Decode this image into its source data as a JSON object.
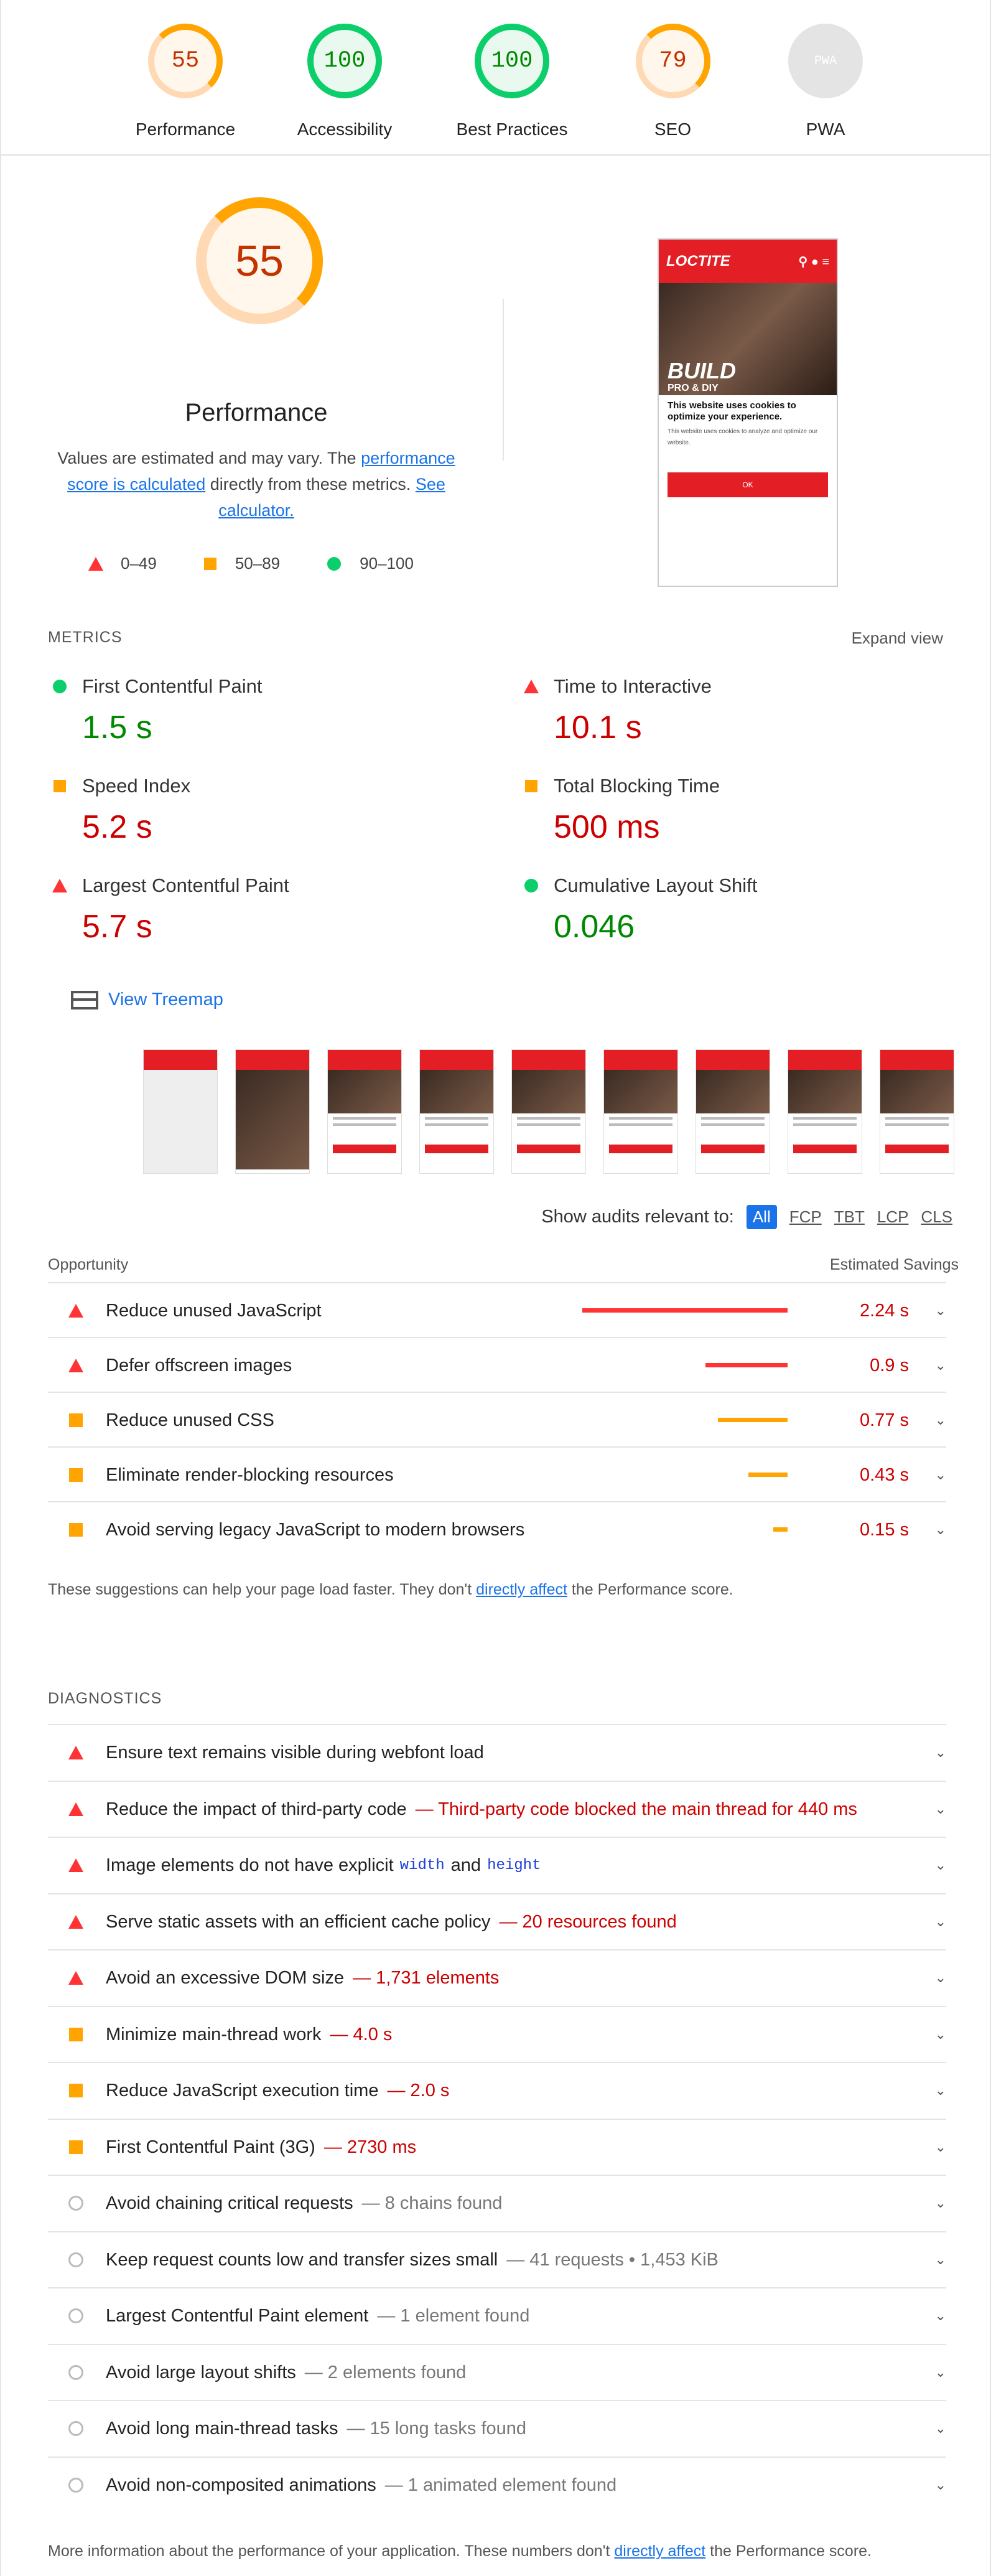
{
  "top_gauges": [
    {
      "score": "55",
      "label": "Performance",
      "status": "average"
    },
    {
      "score": "100",
      "label": "Accessibility",
      "status": "pass"
    },
    {
      "score": "100",
      "label": "Best Practices",
      "status": "pass"
    },
    {
      "score": "79",
      "label": "SEO",
      "status": "average"
    },
    {
      "score": "PWA",
      "label": "PWA",
      "status": "na"
    }
  ],
  "hero": {
    "score": "55",
    "title": "Performance",
    "desc_pre": "Values are estimated and may vary. The ",
    "desc_link1": "performance score is calculated",
    "desc_mid": " directly from these metrics. ",
    "desc_link2": "See calculator.",
    "legend": [
      "0–49",
      "50–89",
      "90–100"
    ]
  },
  "screenshot": {
    "brand": "LOCTITE",
    "headline": "BUILD",
    "subhead": "PRO & DIY",
    "cookie_title": "This website uses cookies to optimize your experience.",
    "cookie_body": "This website uses cookies to analyze and optimize our website. ",
    "button": "OK"
  },
  "metrics": {
    "heading": "METRICS",
    "expand": "Expand view",
    "items": [
      {
        "name": "First Contentful Paint",
        "value": "1.5 s",
        "status": "pass"
      },
      {
        "name": "Time to Interactive",
        "value": "10.1 s",
        "status": "fail"
      },
      {
        "name": "Speed Index",
        "value": "5.2 s",
        "status": "average"
      },
      {
        "name": "Total Blocking Time",
        "value": "500 ms",
        "status": "average"
      },
      {
        "name": "Largest Contentful Paint",
        "value": "5.7 s",
        "status": "fail"
      },
      {
        "name": "Cumulative Layout Shift",
        "value": "0.046",
        "status": "pass"
      }
    ]
  },
  "treemap": "View Treemap",
  "filter": {
    "label": "Show audits relevant to:",
    "options": [
      "All",
      "FCP",
      "TBT",
      "LCP",
      "CLS"
    ]
  },
  "opportunity": {
    "heading": "Opportunity",
    "savings_heading": "Estimated Savings",
    "items": [
      {
        "title": "Reduce unused JavaScript",
        "savings": "2.24 s",
        "status": "fail",
        "bar_fraction": 1.0
      },
      {
        "title": "Defer offscreen images",
        "savings": "0.9 s",
        "status": "fail",
        "bar_fraction": 0.4
      },
      {
        "title": "Reduce unused CSS",
        "savings": "0.77 s",
        "status": "average",
        "bar_fraction": 0.34
      },
      {
        "title": "Eliminate render-blocking resources",
        "savings": "0.43 s",
        "status": "average",
        "bar_fraction": 0.19
      },
      {
        "title": "Avoid serving legacy JavaScript to modern browsers",
        "savings": "0.15 s",
        "status": "average",
        "bar_fraction": 0.07
      }
    ],
    "note_pre": "These suggestions can help your page load faster. They don't ",
    "note_link": "directly affect",
    "note_post": " the Performance score."
  },
  "diagnostics": {
    "heading": "DIAGNOSTICS",
    "items": [
      {
        "title": "Ensure text remains visible during webfont load",
        "detail": "",
        "status": "fail"
      },
      {
        "title": "Reduce the impact of third-party code",
        "detail": "— Third-party code blocked the main thread for 440 ms",
        "status": "fail"
      },
      {
        "title": "Image elements do not have explicit",
        "code1": "width",
        "mid": "and",
        "code2": "height",
        "status": "fail"
      },
      {
        "title": "Serve static assets with an efficient cache policy",
        "detail": "— 20 resources found",
        "status": "fail"
      },
      {
        "title": "Avoid an excessive DOM size",
        "detail": "— 1,731 elements",
        "status": "fail"
      },
      {
        "title": "Minimize main-thread work",
        "detail": "— 4.0 s",
        "status": "average"
      },
      {
        "title": "Reduce JavaScript execution time",
        "detail": "— 2.0 s",
        "status": "average"
      },
      {
        "title": "First Contentful Paint (3G)",
        "detail": "— 2730 ms",
        "status": "average"
      },
      {
        "title": "Avoid chaining critical requests",
        "detail": "— 8 chains found",
        "status": "info"
      },
      {
        "title": "Keep request counts low and transfer sizes small",
        "detail": "— 41 requests • 1,453 KiB",
        "status": "info"
      },
      {
        "title": "Largest Contentful Paint element",
        "detail": "— 1 element found",
        "status": "info"
      },
      {
        "title": "Avoid large layout shifts",
        "detail": "— 2 elements found",
        "status": "info"
      },
      {
        "title": "Avoid long main-thread tasks",
        "detail": "— 15 long tasks found",
        "status": "info"
      },
      {
        "title": "Avoid non-composited animations",
        "detail": "— 1 animated element found",
        "status": "info"
      }
    ],
    "note_pre": "More information about the performance of your application. These numbers don't ",
    "note_link": "directly affect",
    "note_post": " the Performance score."
  },
  "colors": {
    "fail": "#ff3333",
    "average": "#ffa400",
    "pass": "#0cce6b",
    "fail_text": "#cc0000",
    "pass_text": "#008800"
  }
}
